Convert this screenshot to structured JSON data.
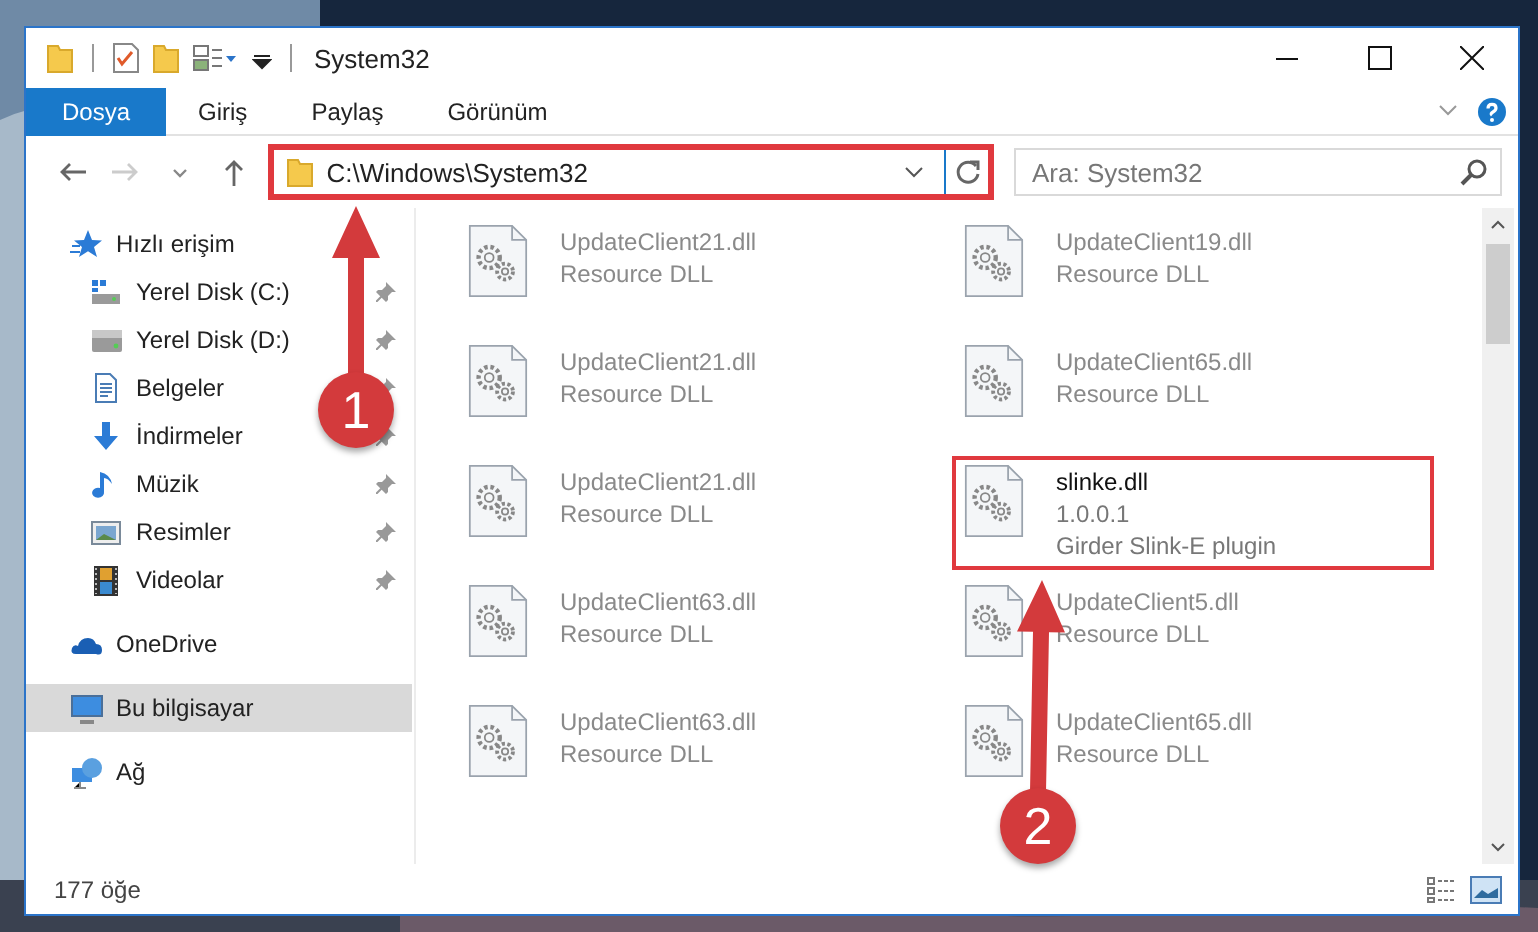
{
  "window": {
    "title": "System32"
  },
  "ribbon_tabs": [
    {
      "label": "Dosya",
      "selected": true
    },
    {
      "label": "Giriş",
      "selected": false
    },
    {
      "label": "Paylaş",
      "selected": false
    },
    {
      "label": "Görünüm",
      "selected": false
    }
  ],
  "address_bar": {
    "path": "C:\\Windows\\System32",
    "highlighted": true
  },
  "search": {
    "placeholder": "Ara: System32"
  },
  "navigation": [
    {
      "label": "Hızlı erişim",
      "selected": false,
      "children": [
        {
          "label": "Yerel Disk (C:)",
          "pinned": true,
          "selected": false
        },
        {
          "label": "Yerel Disk (D:)",
          "pinned": true,
          "selected": false
        },
        {
          "label": "Belgeler",
          "pinned": true,
          "selected": false
        },
        {
          "label": "İndirmeler",
          "pinned": true,
          "selected": false
        },
        {
          "label": "Müzik",
          "pinned": true,
          "selected": false
        },
        {
          "label": "Resimler",
          "pinned": true,
          "selected": false
        },
        {
          "label": "Videolar",
          "pinned": true,
          "selected": false
        }
      ]
    },
    {
      "label": "OneDrive",
      "selected": false
    },
    {
      "label": "Bu bilgisayar",
      "selected": true
    },
    {
      "label": "Ağ",
      "selected": false
    }
  ],
  "files": [
    {
      "name": "UpdateClient21.dll",
      "description": "Resource DLL",
      "blurred": true,
      "highlighted": false
    },
    {
      "name": "UpdateClient19.dll",
      "description": "Resource DLL",
      "blurred": true,
      "highlighted": false
    },
    {
      "name": "UpdateClient21.dll",
      "description": "Resource DLL",
      "blurred": true,
      "highlighted": false
    },
    {
      "name": "UpdateClient65.dll",
      "description": "Resource DLL",
      "blurred": true,
      "highlighted": false
    },
    {
      "name": "UpdateClient21.dll",
      "description": "Resource DLL",
      "blurred": true,
      "highlighted": false
    },
    {
      "name": "slinke.dll",
      "version": "1.0.0.1",
      "description": "Girder Slink-E plugin",
      "blurred": false,
      "highlighted": true
    },
    {
      "name": "UpdateClient63.dll",
      "description": "Resource DLL",
      "blurred": true,
      "highlighted": false
    },
    {
      "name": "UpdateClient5.dll",
      "description": "Resource DLL",
      "blurred": true,
      "highlighted": false
    },
    {
      "name": "UpdateClient63.dll",
      "description": "Resource DLL",
      "blurred": true,
      "highlighted": false
    },
    {
      "name": "UpdateClient65.dll",
      "description": "Resource DLL",
      "blurred": true,
      "highlighted": false
    }
  ],
  "status_bar": {
    "item_count": "177 öğe"
  },
  "annotations": [
    {
      "label": "1"
    },
    {
      "label": "2"
    }
  ]
}
